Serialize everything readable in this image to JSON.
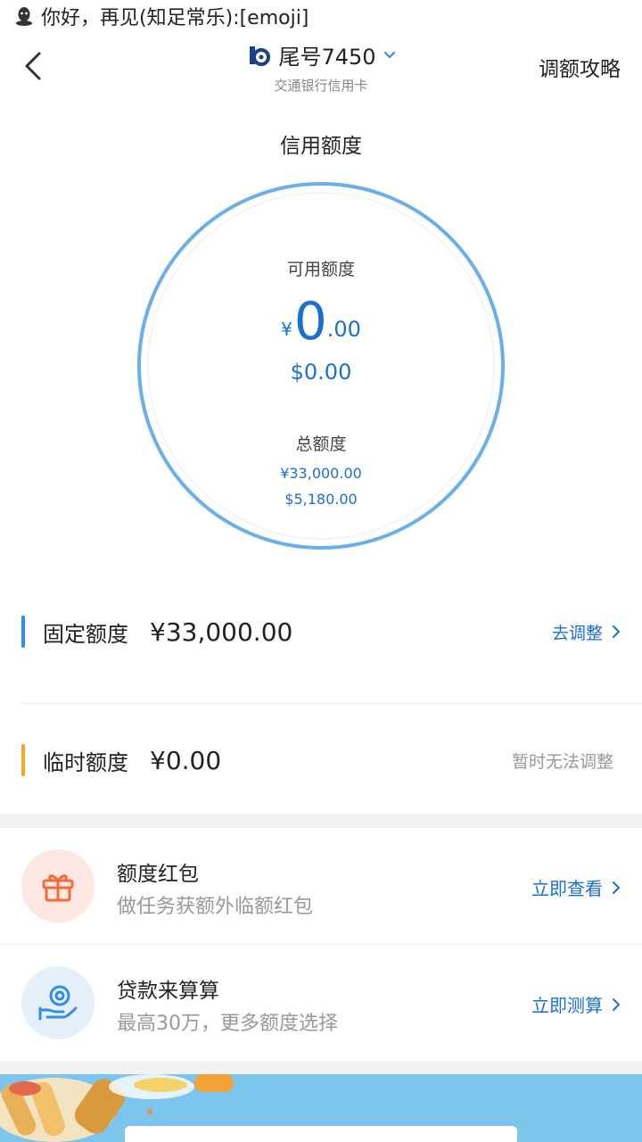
{
  "status_bar": {
    "message": "你好，再见(知足常乐):[emoji]"
  },
  "header": {
    "card_tail": "尾号7450",
    "bank_name": "交通银行信用卡",
    "right_link": "调额攻略"
  },
  "credit": {
    "title": "信用额度",
    "available_label": "可用额度",
    "available_currency": "¥",
    "available_int": "0",
    "available_dec": ".00",
    "available_usd": "$0.00",
    "total_label": "总额度",
    "total_cny": "¥33,000.00",
    "total_usd": "$5,180.00"
  },
  "limits": [
    {
      "name": "固定额度",
      "value": "¥33,000.00",
      "action": "去调整",
      "bar_color": "#2f8cf0",
      "action_color": "#1a6fd1"
    },
    {
      "name": "临时额度",
      "value": "¥0.00",
      "action": "暂时无法调整",
      "bar_color": "#f5a623",
      "action_color": "#999999"
    }
  ],
  "promos": [
    {
      "title": "额度红包",
      "subtitle": "做任务获额外临额红包",
      "action": "立即查看",
      "icon": "gift-icon"
    },
    {
      "title": "贷款来算算",
      "subtitle": "最高30万，更多额度选择",
      "action": "立即测算",
      "icon": "coin-hand-icon"
    }
  ],
  "colors": {
    "accent": "#1a6fd1",
    "ring": "#6aaeea"
  }
}
